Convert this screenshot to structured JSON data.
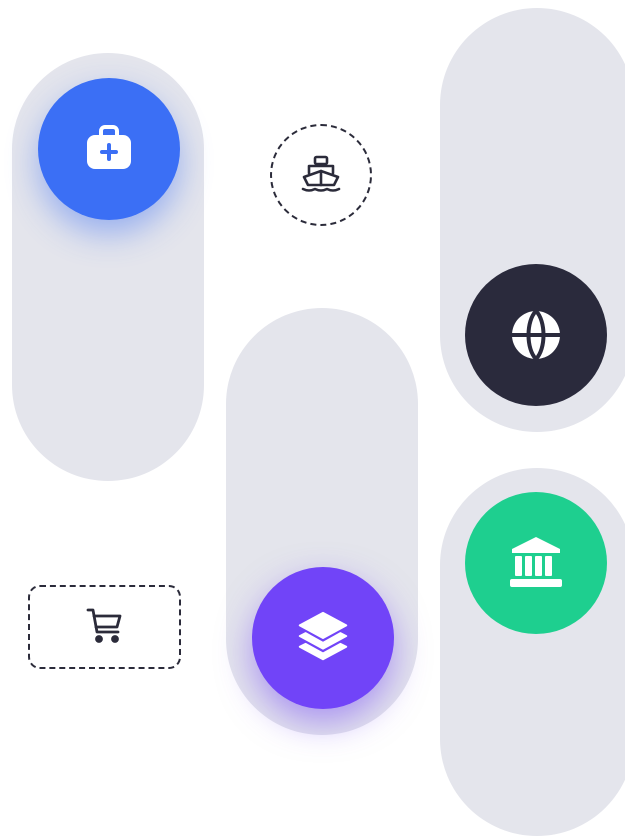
{
  "icons": {
    "medical": {
      "name": "medical-kit-icon",
      "color": "#3b6ff5"
    },
    "ship": {
      "name": "ship-icon",
      "color": "#2b2b3a"
    },
    "globe": {
      "name": "globe-icon",
      "color": "#2a2a3c"
    },
    "bank": {
      "name": "bank-icon",
      "color": "#1ecf8f"
    },
    "cart": {
      "name": "shopping-cart-icon",
      "color": "#2b2b3a"
    },
    "layers": {
      "name": "layers-icon",
      "color": "#7144f8"
    }
  },
  "colors": {
    "pill_background": "#e4e5ec",
    "page_background": "#ffffff"
  }
}
